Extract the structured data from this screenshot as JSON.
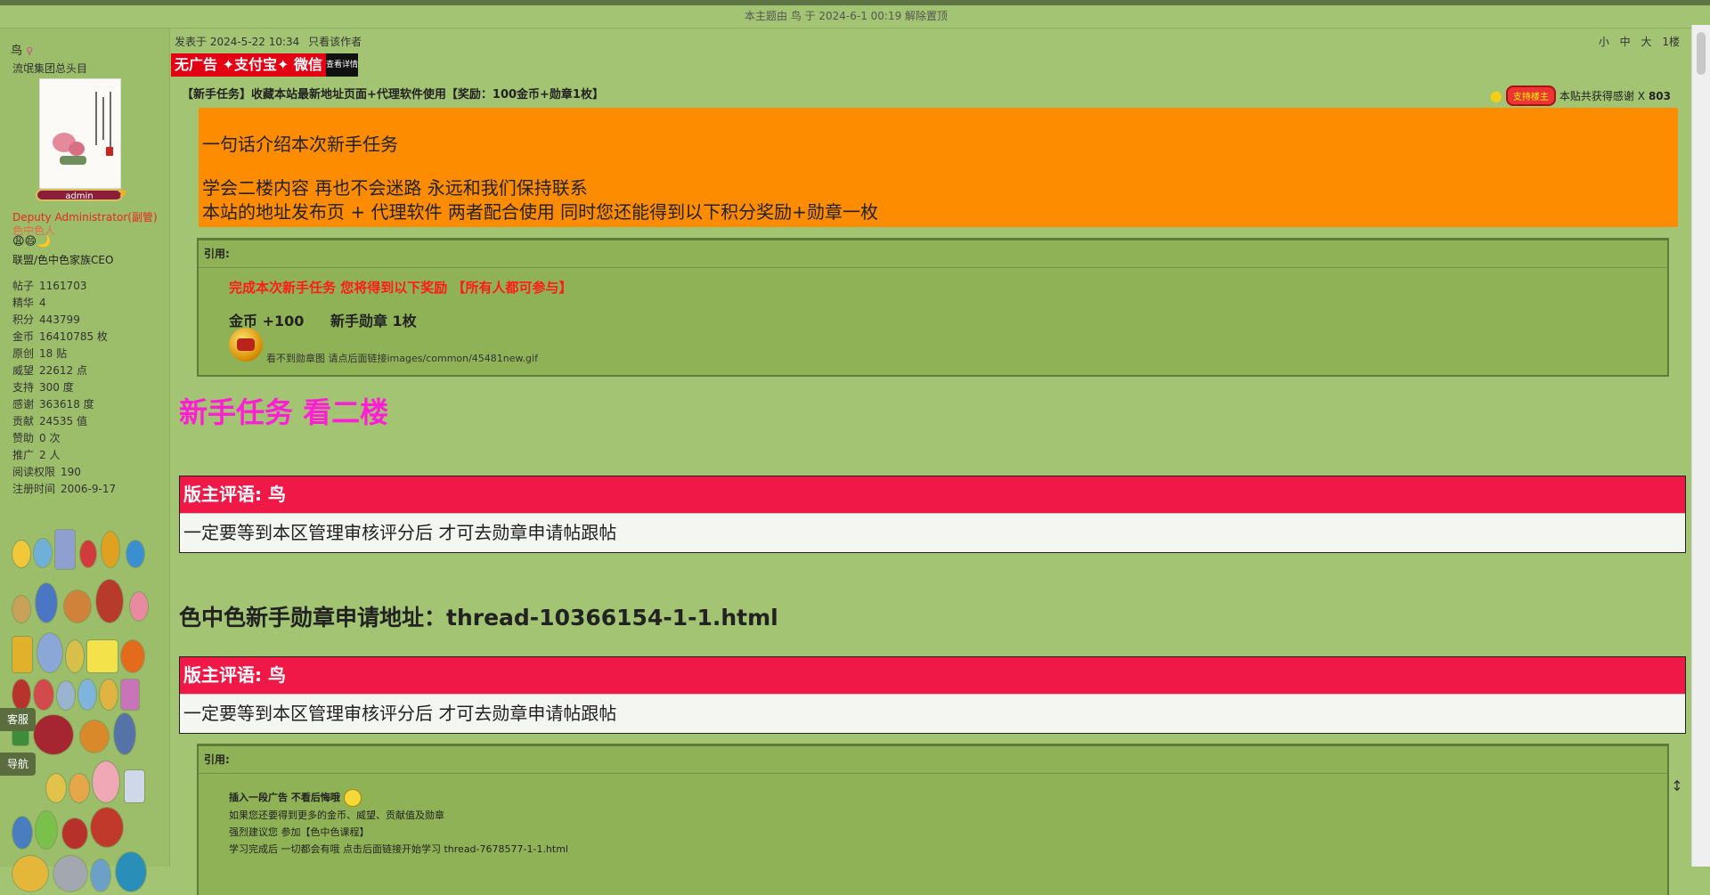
{
  "topbar": {
    "text": "本主题由 鸟 于 2024-6-1 00:19 解除置顶"
  },
  "author": {
    "name": "鸟",
    "gender": "♀",
    "title": "流氓集团总头目",
    "badge": "admin",
    "group": "Deputy Administrator(副管)",
    "group_extra": "色中色人",
    "smileys": "😩😄🌙",
    "honor": "联盟/色中色家族CEO",
    "stats": [
      {
        "label": "帖子",
        "value": "1161703"
      },
      {
        "label": "精华",
        "value": "4"
      },
      {
        "label": "积分",
        "value": "443799"
      },
      {
        "label": "金币",
        "value": "16410785 枚"
      },
      {
        "label": "原创",
        "value": "18 贴"
      },
      {
        "label": "威望",
        "value": "22612 点"
      },
      {
        "label": "支持",
        "value": "300 度"
      },
      {
        "label": "感谢",
        "value": "363618 度"
      },
      {
        "label": "贡献",
        "value": "24535 值"
      },
      {
        "label": "赞助",
        "value": "0 次"
      },
      {
        "label": "推广",
        "value": "2 人"
      },
      {
        "label": "阅读权限",
        "value": "190"
      },
      {
        "label": "注册时间",
        "value": "2006-9-17"
      }
    ]
  },
  "side_tabs": {
    "service": "客服",
    "nav": "导航"
  },
  "post": {
    "meta": "发表于 2024-5-22 10:34",
    "only_author": "只看该作者",
    "font_small": "小",
    "font_medium": "中",
    "font_large": "大",
    "floor": "1楼",
    "ad_text": "无广告 ✦支付宝✦ 微信",
    "ad_tag": "查看详情",
    "thread_title": "【新手任务】收藏本站最新地址页面+代理软件使用【奖励：100金币+勋章1枚】",
    "thanks_badge": "支持楼主",
    "thanks_label": "本贴共获得感谢 X",
    "thanks_count": "803",
    "orange_lines": [
      "一句话介绍本次新手任务",
      "学会二楼内容  再也不会迷路 永远和我们保持联系",
      "本站的地址发布页 +  代理软件   两者配合使用  同时您还能得到以下积分奖励+勋章一枚"
    ],
    "quote_label": "引用:",
    "reward_title": "完成本次新手任务  您将得到以下奖励  【所有人都可参与】",
    "reward_gold": "金币 +100",
    "reward_medal": "新手勋章 1枚",
    "medal_note": "看不到勋章图 请点后面链接images/common/45481new.gif",
    "task_heading": "新手任务  看二楼",
    "mod_comment_header": "版主评语: 鸟",
    "mod_comment_body": "一定要等到本区管理审核评分后  才可去勋章申请帖跟帖",
    "apply_address": "色中色新手勋章申请地址：thread-10366154-1-1.html",
    "quote2_lines": [
      "插入一段广告 不看后悔哦",
      "如果您还要得到更多的金币、威望、贡献值及勋章",
      "强烈建议您  参加【色中色课程】",
      "学习完成后  一切都会有哦   点击后面链接开始学习  thread-7678577-1-1.html"
    ]
  },
  "colors": {
    "page_bg": "#a3c472",
    "orange_block": "#fe8c00",
    "mod_header": "#ef1846",
    "task_heading": "#ff1dd6",
    "reward_title": "#ff1a1a"
  }
}
